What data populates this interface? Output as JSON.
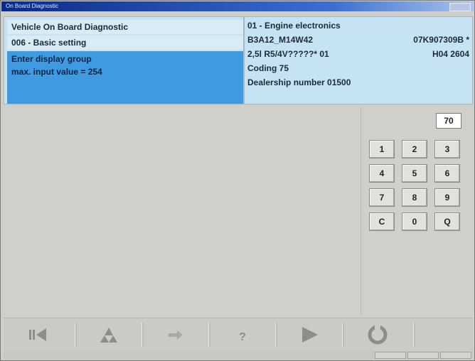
{
  "window": {
    "title": "On Board Diagnostic"
  },
  "header": {
    "left": {
      "app_title": "Vehicle On Board Diagnostic",
      "function": "006 - Basic setting",
      "prompt": "Enter display group",
      "limit": "max. input value = 254"
    },
    "right": {
      "module": "01 - Engine electronics",
      "software": "B3A12_M14W42",
      "part_number": "07K907309B *",
      "engine": "2,5l R5/4V?????* 01",
      "version": "H04  2604",
      "coding": "Coding 75",
      "dealership": "Dealership number 01500"
    }
  },
  "keypad": {
    "entered_value": "70",
    "keys": [
      "1",
      "2",
      "3",
      "4",
      "5",
      "6",
      "7",
      "8",
      "9",
      "C",
      "0",
      "Q"
    ]
  },
  "toolbar": {
    "buttons": [
      "back-icon",
      "print-icon",
      "jump-icon",
      "help-icon",
      "forward-icon",
      "refresh-icon"
    ]
  },
  "colors": {
    "header_bg": "#c5e3f2",
    "prompt_bg": "#3f9ae2",
    "title_bar": "#0a2a8a"
  }
}
